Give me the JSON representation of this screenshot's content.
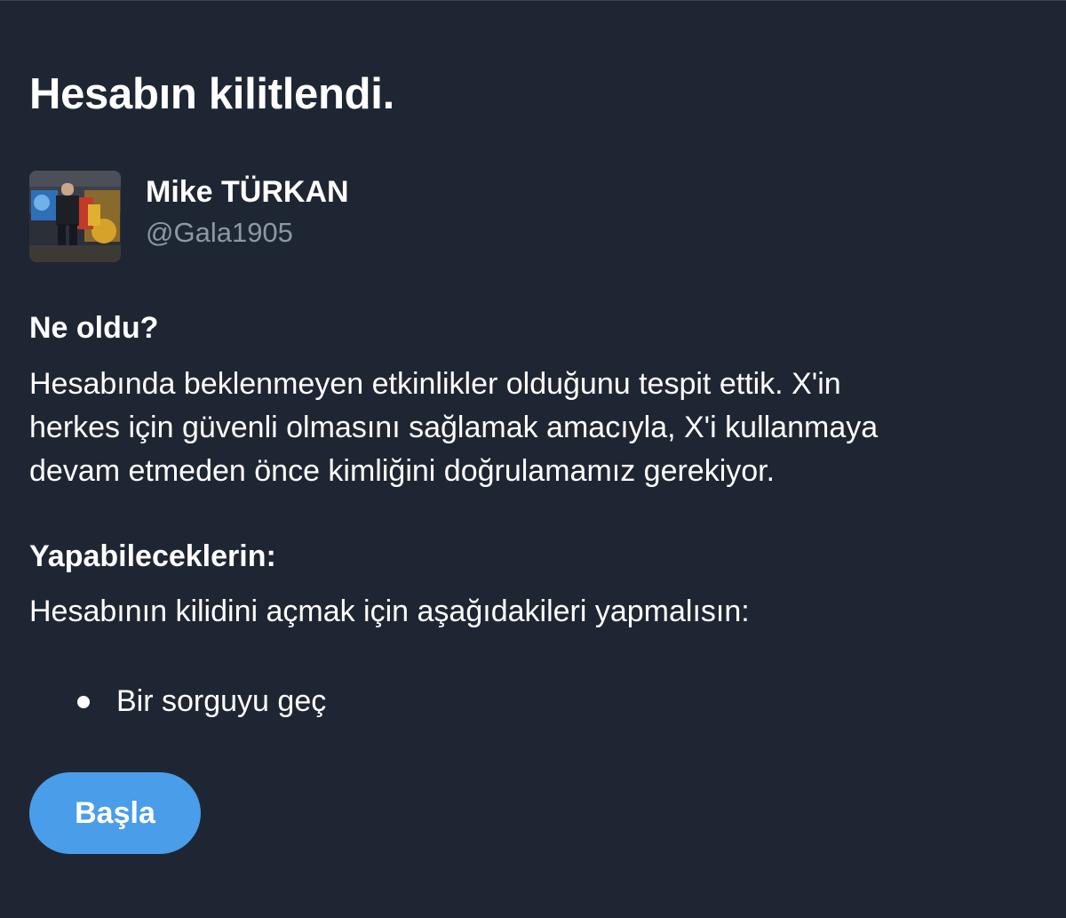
{
  "title": "Hesabın kilitlendi.",
  "account": {
    "display_name": "Mike TÜRKAN",
    "username": "@Gala1905"
  },
  "what_happened": {
    "heading": "Ne oldu?",
    "lines": [
      "Hesabında beklenmeyen etkinlikler olduğunu tespit ettik. X'in",
      "herkes için güvenli olmasını sağlamak amacıyla, X'i kullanmaya",
      "devam etmeden önce kimliğini doğrulamamız gerekiyor."
    ]
  },
  "what_you_can_do": {
    "heading": "Yapabileceklerin:",
    "text": "Hesabının kilidini açmak için aşağıdakileri yapmalısın:",
    "steps": [
      "Bir sorguyu geç"
    ]
  },
  "start_button_label": "Başla",
  "colors": {
    "background": "#1f2633",
    "text": "#ffffff",
    "muted": "#8b98a5",
    "accent": "#4a9de8"
  }
}
